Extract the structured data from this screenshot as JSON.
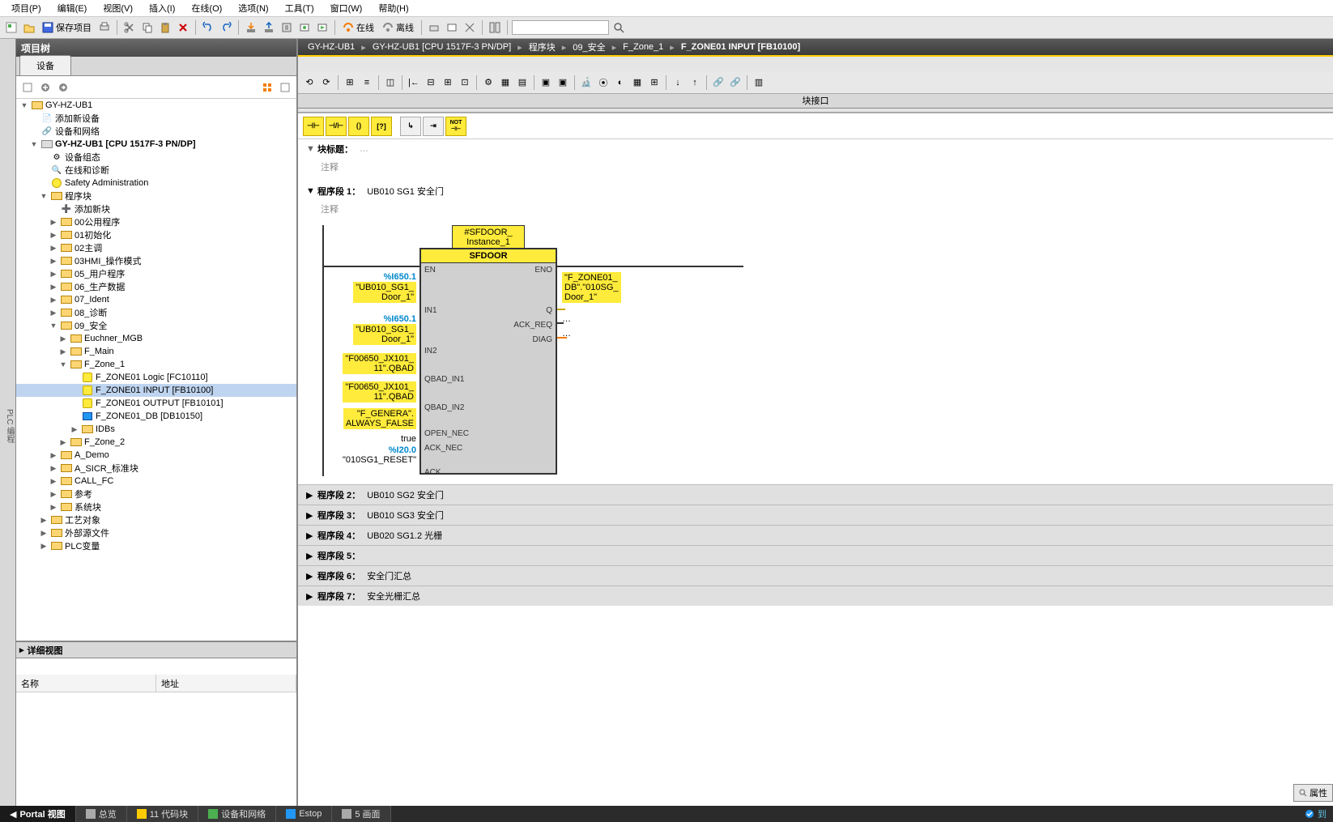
{
  "menu": {
    "items": [
      "项目(P)",
      "编辑(E)",
      "视图(V)",
      "插入(I)",
      "在线(O)",
      "选项(N)",
      "工具(T)",
      "窗口(W)",
      "帮助(H)"
    ]
  },
  "toolbar": {
    "save": "保存项目",
    "online": "在线",
    "offline": "离线"
  },
  "project_tree": {
    "title": "项目树",
    "tab": "设备",
    "root": "GY-HZ-UB1",
    "add_device": "添加新设备",
    "dev_network": "设备和网络",
    "cpu": "GY-HZ-UB1 [CPU 1517F-3 PN/DP]",
    "dev_config": "设备组态",
    "online_diag": "在线和诊断",
    "safety": "Safety Administration",
    "program_blocks": "程序块",
    "add_block": "添加新块",
    "g00": "00公用程序",
    "g01": "01初始化",
    "g02": "02主调",
    "g03": "03HMI_操作模式",
    "g05": "05_用户程序",
    "g06": "06_生产数据",
    "g07": "07_Ident",
    "g08": "08_诊断",
    "g09": "09_安全",
    "euchner": "Euchner_MGB",
    "fmain": "F_Main",
    "fzone1": "F_Zone_1",
    "fc_logic": "F_ZONE01 Logic [FC10110]",
    "fb_input": "F_ZONE01 INPUT [FB10100]",
    "fb_output": "F_ZONE01 OUTPUT [FB10101]",
    "db": "F_ZONE01_DB [DB10150]",
    "idbs": "IDBs",
    "fzone2": "F_Zone_2",
    "ademo": "A_Demo",
    "asicr": "A_SICR_标准块",
    "callfc": "CALL_FC",
    "ref": "参考",
    "sysblock": "系统块",
    "techobj": "工艺对象",
    "extsrc": "外部源文件",
    "plcvar": "PLC变量"
  },
  "detail": {
    "title": "详细视图",
    "col_name": "名称",
    "col_addr": "地址"
  },
  "breadcrumb": {
    "p1": "GY-HZ-UB1",
    "p2": "GY-HZ-UB1 [CPU 1517F-3 PN/DP]",
    "p3": "程序块",
    "p4": "09_安全",
    "p5": "F_Zone_1",
    "p6": "F_ZONE01 INPUT [FB10100]"
  },
  "interface_label": "块接口",
  "lad_buttons": {
    "nc": "⊣ ⊢",
    "no": "⊣/⊢",
    "coil": "⊸",
    "box": "⊡",
    "branch": "→",
    "arrow": "⇥",
    "not": "NOT"
  },
  "block": {
    "title": "块标题：",
    "ellipsis": "…",
    "comment": "注释"
  },
  "network1": {
    "title": "程序段 1：",
    "desc": "UB010 SG1 安全门",
    "comment": "注释",
    "instance": "#SFDOOR_\nInstance_1",
    "fb_name": "SFDOOR",
    "pins_left": [
      "EN",
      "IN1",
      "IN2",
      "QBAD_IN1",
      "QBAD_IN2",
      "OPEN_NEC",
      "ACK_NEC",
      "ACK"
    ],
    "pins_right": [
      "ENO",
      "Q",
      "ACK_REQ",
      "DIAG"
    ],
    "in1_addr": "%I650.1",
    "in1_sym": "\"UB010_SG1_\nDoor_1\"",
    "in2_addr": "%I650.1",
    "in2_sym": "\"UB010_SG1_\nDoor_1\"",
    "qbad1": "\"F00650_JX101_\n11\".QBAD",
    "qbad2": "\"F00650_JX101_\n11\".QBAD",
    "opennec": "\"F_GENERA\".\nALWAYS_FALSE",
    "acknec": "true",
    "ack_addr": "%I20.0",
    "ack_sym": "\"010SG1_RESET\"",
    "q_sym": "\"F_ZONE01_\nDB\".\"010SG_\nDoor_1\"",
    "ellipsis": "…"
  },
  "networks_collapsed": [
    {
      "title": "程序段 2：",
      "desc": "UB010 SG2 安全门"
    },
    {
      "title": "程序段 3：",
      "desc": "UB010 SG3 安全门"
    },
    {
      "title": "程序段 4：",
      "desc": "UB020 SG1.2 光栅"
    },
    {
      "title": "程序段 5：",
      "desc": ""
    },
    {
      "title": "程序段 6：",
      "desc": "安全门汇总"
    },
    {
      "title": "程序段 7：",
      "desc": "安全光栅汇总"
    }
  ],
  "right_tab": "属性",
  "status": {
    "portal": "Portal 视图",
    "overview": "总览",
    "code": "11 代码块",
    "devnet": "设备和网络",
    "estop": "Estop",
    "screen": "5 画面",
    "right": "到"
  }
}
